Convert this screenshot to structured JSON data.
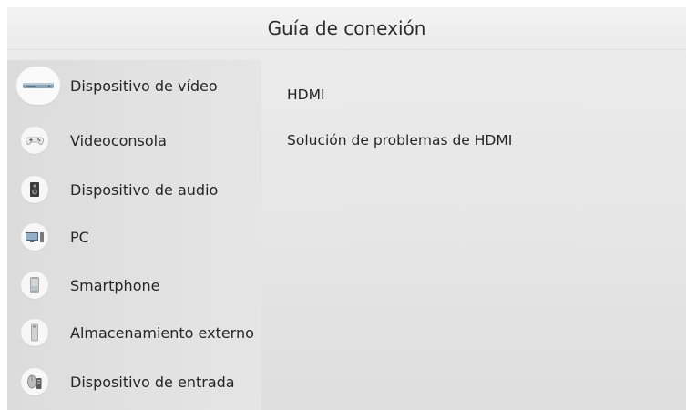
{
  "header": {
    "title": "Guía de conexión"
  },
  "sidebar": {
    "items": [
      {
        "label": "Dispositivo de vídeo",
        "icon": "video-player-icon",
        "selected": true
      },
      {
        "label": "Videoconsola",
        "icon": "gamepad-icon",
        "selected": false
      },
      {
        "label": "Dispositivo de audio",
        "icon": "speaker-icon",
        "selected": false
      },
      {
        "label": "PC",
        "icon": "pc-icon",
        "selected": false
      },
      {
        "label": "Smartphone",
        "icon": "smartphone-icon",
        "selected": false
      },
      {
        "label": "Almacenamiento externo",
        "icon": "external-storage-icon",
        "selected": false
      },
      {
        "label": "Dispositivo de entrada",
        "icon": "input-device-icon",
        "selected": false
      }
    ]
  },
  "main": {
    "options": [
      {
        "label": "HDMI"
      },
      {
        "label": "Solución de problemas de HDMI"
      }
    ]
  }
}
